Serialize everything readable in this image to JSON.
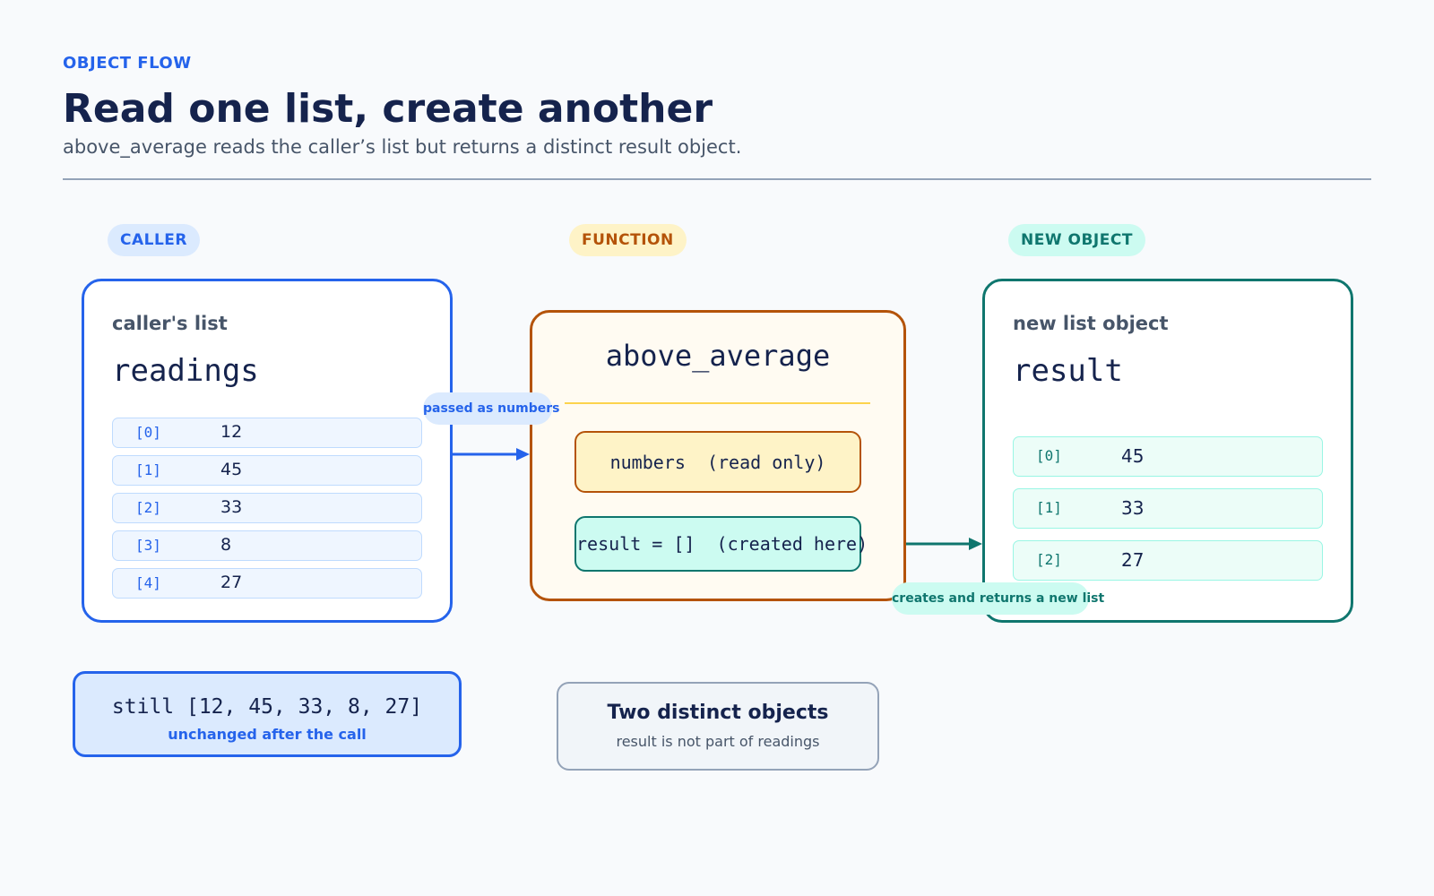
{
  "header": {
    "eyebrow": "OBJECT FLOW",
    "title": "Read one list, create another",
    "subtitle": "above_average reads the caller’s list but returns a distinct result object."
  },
  "caller": {
    "pill": "CALLER",
    "label": "caller's list",
    "var_name": "readings",
    "items": [
      {
        "index": "[0]",
        "value": "12"
      },
      {
        "index": "[1]",
        "value": "45"
      },
      {
        "index": "[2]",
        "value": "33"
      },
      {
        "index": "[3]",
        "value": "8"
      },
      {
        "index": "[4]",
        "value": "27"
      }
    ]
  },
  "function": {
    "pill": "FUNCTION",
    "name": "above_average",
    "read_box": "numbers  (read only)",
    "result_box": "result = []  (created here)"
  },
  "new_object": {
    "pill": "NEW OBJECT",
    "label": "new list object",
    "var_name": "result",
    "items": [
      {
        "index": "[0]",
        "value": "45"
      },
      {
        "index": "[1]",
        "value": "33"
      },
      {
        "index": "[2]",
        "value": "27"
      }
    ]
  },
  "arrows": {
    "passed_label": "passed as numbers",
    "creates_label": "creates and returns a new list"
  },
  "still_note": {
    "main": "still [12, 45, 33, 8, 27]",
    "sub": "unchanged after the call"
  },
  "distinct_note": {
    "title": "Two distinct objects",
    "sub": "result is not part of readings"
  },
  "colors": {
    "caller_accent": "#2563eb",
    "function_accent": "#b45309",
    "new_object_accent": "#0f766e",
    "title_color": "#15234d"
  }
}
